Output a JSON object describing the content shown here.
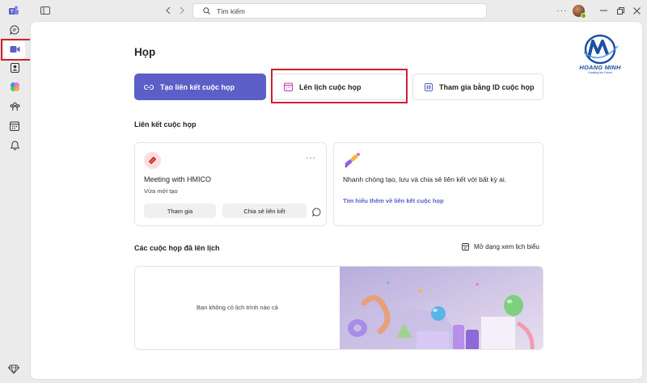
{
  "titlebar": {
    "search_placeholder": "Tìm kiếm",
    "more_label": "···"
  },
  "rail": {
    "items": [
      {
        "name": "chat",
        "icon": "chat-icon"
      },
      {
        "name": "meet",
        "icon": "video-camera-icon",
        "active": true
      },
      {
        "name": "contacts",
        "icon": "contact-card-icon"
      },
      {
        "name": "copilot",
        "icon": "copilot-icon"
      },
      {
        "name": "communities",
        "icon": "people-group-icon"
      },
      {
        "name": "calendar",
        "icon": "calendar-icon"
      },
      {
        "name": "activity",
        "icon": "bell-icon"
      }
    ]
  },
  "main": {
    "title": "Họp",
    "logo": {
      "text": "HOANG MINH",
      "tagline": "Creating the Future"
    },
    "actions": {
      "create_link": "Tạo liên kết cuộc họp",
      "schedule": "Lên lịch cuộc họp",
      "join_by_id": "Tham gia bằng ID cuộc họp"
    },
    "links_section": {
      "title": "Liên kết cuộc họp",
      "meeting": {
        "title": "Meeting with HMICO",
        "subtitle": "Vừa mới tạo",
        "join_label": "Tham gia",
        "share_label": "Chia sẻ liên kết",
        "more_label": "···"
      },
      "promo": {
        "text": "Nhanh chóng tạo, lưu và chia sẻ liên kết với bất kỳ ai.",
        "link": "Tìm hiểu thêm về liên kết cuộc họp"
      }
    },
    "scheduled_section": {
      "title": "Các cuộc họp đã lên lịch",
      "calendar_view": "Mở dạng xem lịch biểu",
      "empty_text": "Bạn không có lịch trình nào cả"
    }
  },
  "colors": {
    "accent": "#5b5fc7",
    "highlight_box": "#d21f2e"
  }
}
